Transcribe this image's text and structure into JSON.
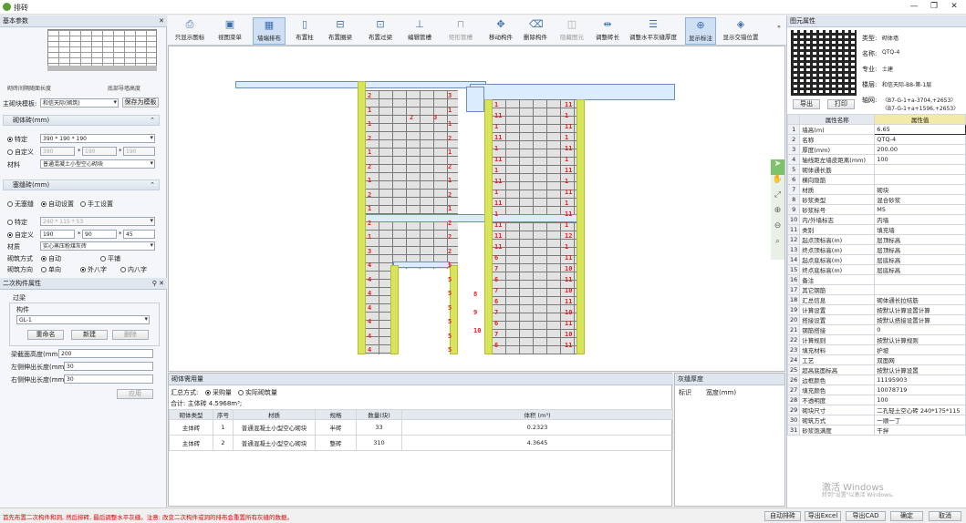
{
  "window": {
    "title": "排砖",
    "controls": [
      "—",
      "❐",
      "✕"
    ]
  },
  "left_panel": {
    "title": "基本参数",
    "close": "✕",
    "preview": {
      "label_left": "砌砖间隔随面长度",
      "label_right": "底部导墙高度"
    },
    "template_label": "主砌块模板:",
    "template_value": "和信天际(砌筑)",
    "save_template": "保存为模板",
    "brick_section": "砌体砖(mm)",
    "brick_specific_label": "特定",
    "brick_specific_value": "390 * 190 * 190",
    "brick_custom_label": "自定义",
    "brick_custom_values": [
      "390",
      "190",
      "190"
    ],
    "material_label": "材料",
    "material_value": "普通混凝土小型空心砌块",
    "bed_section": "塞缝砖(mm)",
    "bed_mode_none": "无塞缝",
    "bed_mode_auto": "自动设置",
    "bed_mode_manual": "手工设置",
    "bed_specific_label": "特定",
    "bed_specific_value": "240 * 115 * 53",
    "bed_custom_label": "自定义",
    "bed_custom_values": [
      "190",
      "90",
      "45"
    ],
    "bed_material_label": "材质",
    "bed_material_value": "实心蒸压粉煤灰砖",
    "laying_label": "砌筑方式",
    "laying_auto": "自动",
    "laying_flat": "平铺",
    "direction_label": "砌筑方向",
    "direction_single": "单向",
    "direction_outer": "外八字",
    "direction_inner": "内八字",
    "times": "*"
  },
  "secondary_panel": {
    "title": "二次构件属性",
    "pin": "⚲ ✕",
    "group_label": "过梁",
    "component_label": "构件",
    "component_value": "GL-1",
    "rename": "重命名",
    "new": "新建",
    "delete": "删除",
    "fields": [
      {
        "label": "梁截面高度(mm)",
        "value": "200"
      },
      {
        "label": "左侧伸出长度(mm)",
        "value": "30"
      },
      {
        "label": "右侧伸出长度(mm)",
        "value": "30"
      }
    ],
    "apply": "应用"
  },
  "toolbar": {
    "buttons": [
      {
        "label": "只显示图标",
        "icon": "⎙",
        "state": "normal"
      },
      {
        "label": "视图菜单",
        "icon": "▣",
        "state": "normal"
      },
      {
        "label": "墙端排布",
        "icon": "▦",
        "state": "active"
      },
      {
        "label": "布置柱",
        "icon": "▯",
        "state": "normal"
      },
      {
        "label": "布置圈梁",
        "icon": "⊟",
        "state": "normal"
      },
      {
        "label": "布置过梁",
        "icon": "⊡",
        "state": "normal"
      },
      {
        "label": "编辑管槽",
        "icon": "⊥",
        "state": "normal"
      },
      {
        "label": "矩形管槽",
        "icon": "⊓",
        "state": "disabled"
      },
      {
        "label": "移动构件",
        "icon": "✥",
        "state": "normal"
      },
      {
        "label": "删除构件",
        "icon": "⌫",
        "state": "normal"
      },
      {
        "label": "隐藏图元",
        "icon": "◫",
        "state": "disabled"
      },
      {
        "label": "调整砖长",
        "icon": "⇹",
        "state": "normal"
      },
      {
        "label": "调整水平灰缝厚度",
        "icon": "☰",
        "state": "normal"
      },
      {
        "label": "显示标注",
        "icon": "⊕",
        "state": "active"
      },
      {
        "label": "显示交错位置",
        "icon": "◈",
        "state": "normal"
      }
    ],
    "more": "»"
  },
  "canvas": {
    "labels_left_a": [
      "2",
      "1",
      "1",
      "2",
      "1",
      "2",
      "1",
      "2",
      "1",
      "2",
      "1",
      "3",
      "4",
      "4",
      "4",
      "4",
      "4",
      "4",
      "4"
    ],
    "labels_right_a": [
      "3",
      "1",
      "1",
      "2",
      "1",
      "2",
      "1",
      "2",
      "1",
      "2",
      "2",
      "2",
      "5",
      "5",
      "5",
      "5",
      "5",
      "5",
      "5"
    ],
    "labels_left_b": [
      "1",
      "11",
      "1",
      "11",
      "1",
      "11",
      "1",
      "11",
      "1",
      "11",
      "1",
      "11",
      "11",
      "11",
      "6",
      "7",
      "6",
      "7",
      "6",
      "7",
      "6",
      "7",
      "6"
    ],
    "labels_right_b": [
      "11",
      "1",
      "11",
      "1",
      "11",
      "1",
      "11",
      "1",
      "11",
      "1",
      "11",
      "1",
      "12",
      "1",
      "11",
      "10",
      "11",
      "10",
      "11",
      "10",
      "11",
      "10",
      "11"
    ],
    "inner_labels": [
      "2",
      "3",
      "8",
      "9",
      "10"
    ]
  },
  "vertical_tools": [
    "➤",
    "✋",
    "⤢",
    "⊕",
    "⊖",
    "⌕"
  ],
  "quantity_panel": {
    "title": "砌体需用量",
    "summary_label": "汇总方式:",
    "summary_buy": "采购量",
    "summary_actual": "实际砌筑量",
    "total": "合计: 主体砖 4.5968m³;",
    "columns": [
      "砌体类型",
      "序号",
      "材质",
      "规格",
      "数量(块)",
      "体积 (m³)"
    ],
    "rows": [
      [
        "主体砖",
        "1",
        "普通混凝土小型空心砌块",
        "半砖",
        "33",
        "0.2323"
      ],
      [
        "主体砖",
        "2",
        "普通混凝土小型空心砌块",
        "整砖",
        "310",
        "4.3645"
      ]
    ]
  },
  "joint_panel": {
    "title": "灰缝厚度",
    "columns": [
      "标识",
      "宽度(mm)"
    ]
  },
  "right_panel": {
    "title": "图元属性",
    "info": [
      {
        "label": "类型:",
        "value": "砌体墙"
      },
      {
        "label": "名称:",
        "value": "QTQ-4"
      },
      {
        "label": "专业:",
        "value": "土建"
      },
      {
        "label": "楼层:",
        "value": "和信天际-B8-第-1层"
      },
      {
        "label": "轴网:",
        "value": "〈B7-G-1+a-3704,+2653〉〈B7-G-1+a+1596,+2653〉"
      }
    ],
    "export": "导出",
    "print": "打印",
    "columns": [
      "属性名称",
      "属性值"
    ],
    "properties": [
      [
        "1",
        "墙高(m)",
        "6.65"
      ],
      [
        "2",
        "名称",
        "QTQ-4"
      ],
      [
        "3",
        "厚度(mm)",
        "200.00"
      ],
      [
        "4",
        "轴线距左墙皮距离(mm)",
        "100"
      ],
      [
        "5",
        "砌体通长筋",
        ""
      ],
      [
        "6",
        "横向隐筋",
        ""
      ],
      [
        "7",
        "材质",
        "砌块"
      ],
      [
        "8",
        "砂浆类型",
        "混合砂浆"
      ],
      [
        "9",
        "砂浆标号",
        "M5"
      ],
      [
        "10",
        "内/外墙标志",
        "内墙"
      ],
      [
        "11",
        "类别",
        "填充墙"
      ],
      [
        "12",
        "起点顶标高(m)",
        "层顶标高"
      ],
      [
        "13",
        "终点顶标高(m)",
        "层顶标高"
      ],
      [
        "14",
        "起点底标高(m)",
        "层底标高"
      ],
      [
        "15",
        "终点底标高(m)",
        "层底标高"
      ],
      [
        "16",
        "备注",
        ""
      ],
      [
        "17",
        "其它钢筋",
        ""
      ],
      [
        "18",
        "汇总信息",
        "砌体通长拉结筋"
      ],
      [
        "19",
        "计算设置",
        "按默认计算设置计算"
      ],
      [
        "20",
        "搭接设置",
        "按默认搭接设置计算"
      ],
      [
        "21",
        "钢筋搭接",
        "0"
      ],
      [
        "22",
        "计算规则",
        "按默认计算规则"
      ],
      [
        "23",
        "填充材料",
        "护坡"
      ],
      [
        "24",
        "工艺",
        "双面网"
      ],
      [
        "25",
        "超高底面标高",
        "按默认计算设置"
      ],
      [
        "26",
        "边框颜色",
        "11195903"
      ],
      [
        "27",
        "填充颜色",
        "10078719"
      ],
      [
        "28",
        "不透明度",
        "100"
      ],
      [
        "29",
        "砌块尺寸",
        "二孔轻土空心砖 240*175*115"
      ],
      [
        "30",
        "砌筑方式",
        "一顺一丁"
      ],
      [
        "31",
        "砂浆饱满度",
        "干拌"
      ]
    ],
    "watermark": "激活 Windows",
    "watermark_sub": "转到\"设置\"以激活 Windows。"
  },
  "status": {
    "message": "首先布置二次构件和洞, 然后排砖, 最后调整水平灰缝。注意: 改变二次构件或洞的排布会重置所有灰缝的数据。",
    "buttons": [
      "自动排砖",
      "导出Excel",
      "导出CAD",
      "确定",
      "取消"
    ]
  }
}
